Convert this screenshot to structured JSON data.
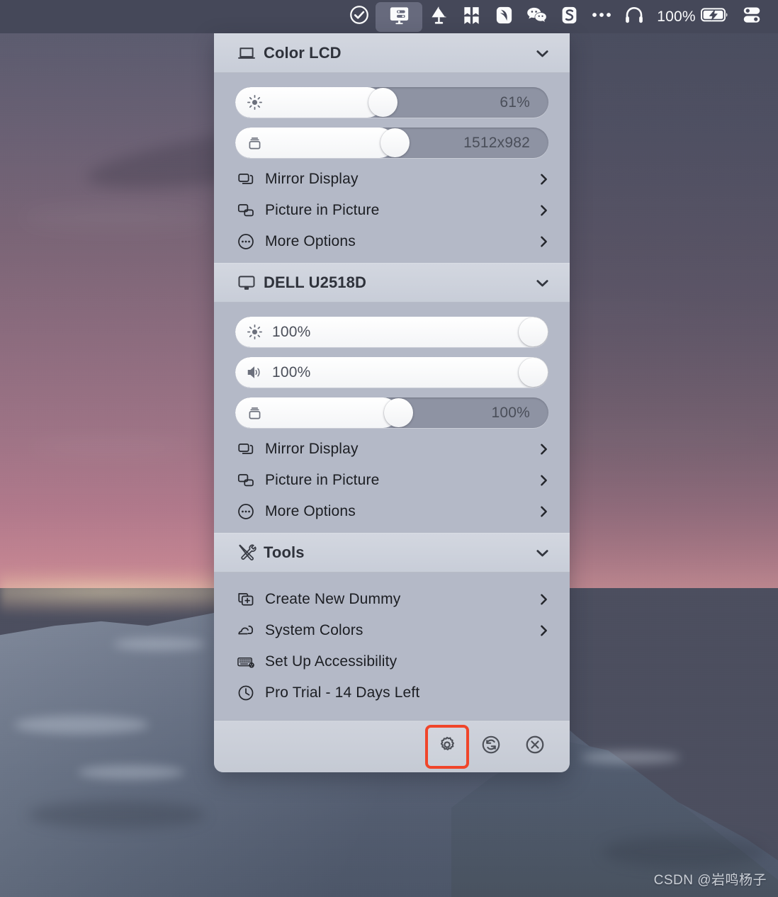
{
  "menubar": {
    "items": [
      {
        "name": "checkmark-circle-icon",
        "label": "",
        "active": false
      },
      {
        "name": "display-settings-icon",
        "label": "",
        "active": true
      },
      {
        "name": "desk-lamp-icon",
        "label": "",
        "active": false
      },
      {
        "name": "bookmark-grid-icon",
        "label": "",
        "active": false
      },
      {
        "name": "wing-app-icon",
        "label": "",
        "active": false
      },
      {
        "name": "wechat-icon",
        "label": "",
        "active": false
      },
      {
        "name": "sogou-input-icon",
        "label": "",
        "active": false
      },
      {
        "name": "ellipsis-icon",
        "label": "",
        "active": false
      },
      {
        "name": "headphones-icon",
        "label": "",
        "active": false
      }
    ],
    "battery_percent": "100%",
    "battery_state": "charging",
    "control_center_icon": "control-center-icon"
  },
  "panel": {
    "sections": [
      {
        "id": "color-lcd",
        "title": "Color LCD",
        "icon": "laptop-display-icon",
        "chevron": "chevron-down-icon",
        "expanded": true,
        "sliders": [
          {
            "id": "brightness",
            "icon": "brightness-sun-icon",
            "value_text": "61%",
            "fill_percent": 47,
            "label_side": "right"
          },
          {
            "id": "resolution",
            "icon": "resolution-stack-icon",
            "value_text": "1512x982",
            "fill_percent": 51,
            "label_side": "right"
          }
        ],
        "rows": [
          {
            "id": "mirror-display",
            "label": "Mirror Display",
            "icon": "mirror-display-icon",
            "chevron": true
          },
          {
            "id": "picture-in-picture",
            "label": "Picture in Picture",
            "icon": "picture-in-picture-icon",
            "chevron": true
          },
          {
            "id": "more-options",
            "label": "More Options",
            "icon": "more-options-icon",
            "chevron": true
          }
        ]
      },
      {
        "id": "dell-u2518d",
        "title": "DELL U2518D",
        "icon": "external-display-icon",
        "chevron": "chevron-down-icon",
        "expanded": true,
        "sliders": [
          {
            "id": "brightness",
            "icon": "brightness-sun-icon",
            "value_text": "100%",
            "fill_percent": 100,
            "label_side": "left"
          },
          {
            "id": "volume",
            "icon": "volume-speaker-icon",
            "value_text": "100%",
            "fill_percent": 100,
            "label_side": "left"
          },
          {
            "id": "resolution",
            "icon": "resolution-stack-icon",
            "value_text": "100%",
            "fill_percent": 52,
            "label_side": "right"
          }
        ],
        "rows": [
          {
            "id": "mirror-display",
            "label": "Mirror Display",
            "icon": "mirror-display-icon",
            "chevron": true
          },
          {
            "id": "picture-in-picture",
            "label": "Picture in Picture",
            "icon": "picture-in-picture-icon",
            "chevron": true
          },
          {
            "id": "more-options",
            "label": "More Options",
            "icon": "more-options-icon",
            "chevron": true
          }
        ]
      },
      {
        "id": "tools",
        "title": "Tools",
        "icon": "tools-hammer-wrench-icon",
        "chevron": "chevron-down-icon",
        "expanded": true,
        "sliders": [],
        "rows": [
          {
            "id": "create-new-dummy",
            "label": "Create New Dummy",
            "icon": "create-new-dummy-icon",
            "chevron": true
          },
          {
            "id": "system-colors",
            "label": "System Colors",
            "icon": "system-colors-cloud-icon",
            "chevron": true
          },
          {
            "id": "set-up-accessibility",
            "label": "Set Up Accessibility",
            "icon": "keyboard-accessibility-icon",
            "chevron": false
          },
          {
            "id": "pro-trial",
            "label": "Pro Trial - 14 Days Left",
            "icon": "clock-icon",
            "chevron": false
          }
        ]
      }
    ],
    "footer": {
      "buttons": [
        {
          "id": "settings",
          "icon": "gear-icon",
          "highlighted": true
        },
        {
          "id": "refresh",
          "icon": "refresh-sync-icon",
          "highlighted": false
        },
        {
          "id": "quit",
          "icon": "close-circle-icon",
          "highlighted": false
        }
      ]
    }
  },
  "watermark": "CSDN @岩鸣杨子",
  "colors": {
    "menubar_bg": "#454859",
    "panel_body_bg": "#b4b9c7",
    "section_header_bg": "#ced2dc",
    "slider_track": "#8e93a3",
    "slider_fill": "#ffffff",
    "annotation_red": "#f0452a",
    "text_primary": "#1c1e23"
  }
}
